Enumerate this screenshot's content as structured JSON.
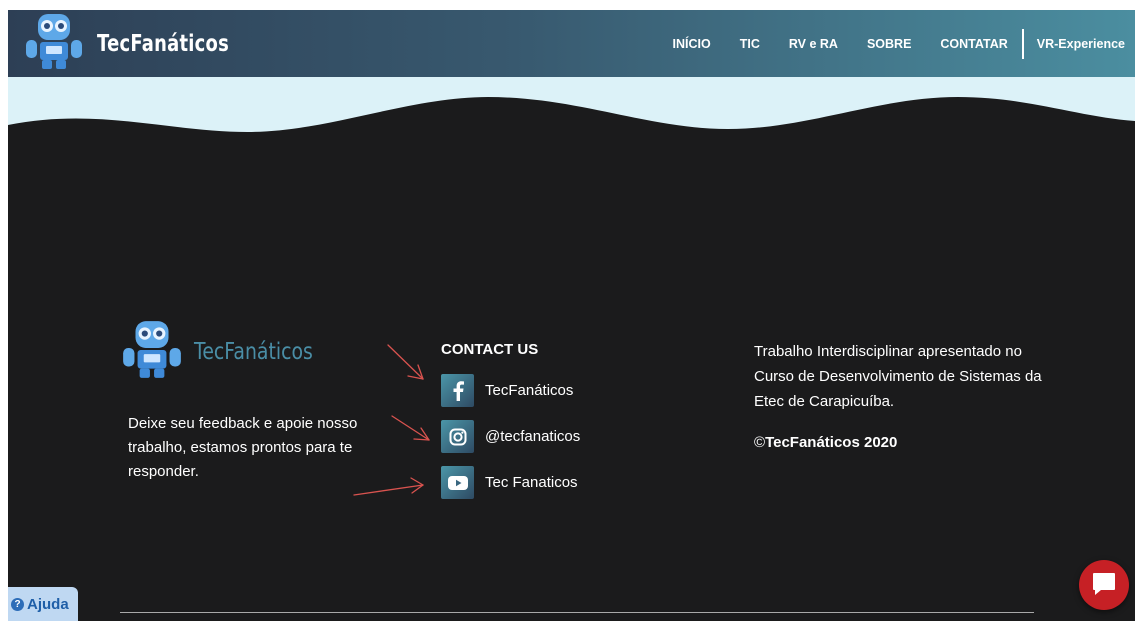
{
  "header": {
    "brand_name": "TecFanáticos",
    "logo_icon": "robot-icon",
    "nav_items": [
      "INÍCIO",
      "TIC",
      "RV e RA",
      "SOBRE",
      "CONTATAR"
    ],
    "vr_link": "VR-Experience"
  },
  "footer": {
    "brand_name": "TecFanáticos",
    "feedback_text": "Deixe seu feedback e apoie nosso trabalho, estamos prontos para te responder.",
    "contact_title": "CONTACT US",
    "social": [
      {
        "icon": "facebook-icon",
        "label": "TecFanáticos"
      },
      {
        "icon": "instagram-icon",
        "label": "@tecfanaticos"
      },
      {
        "icon": "youtube-icon",
        "label": "Tec Fanaticos"
      }
    ],
    "about_text": "Trabalho Interdisciplinar apresentado no Curso de Desenvolvimento de Sistemas da Etec de Carapicuíba.",
    "copyright_symbol": "©",
    "copyright_text": "TecFanáticos 2020"
  },
  "widgets": {
    "help_label": "Ajuda",
    "help_icon": "question-circle-icon",
    "chat_icon": "chat-bubble-icon"
  },
  "colors": {
    "footer_bg": "#1b1b1c",
    "wave_fill": "#dcf2f8",
    "accent": "#4a8ea6",
    "arrow": "#d9534f",
    "chat_button": "#c62025"
  }
}
